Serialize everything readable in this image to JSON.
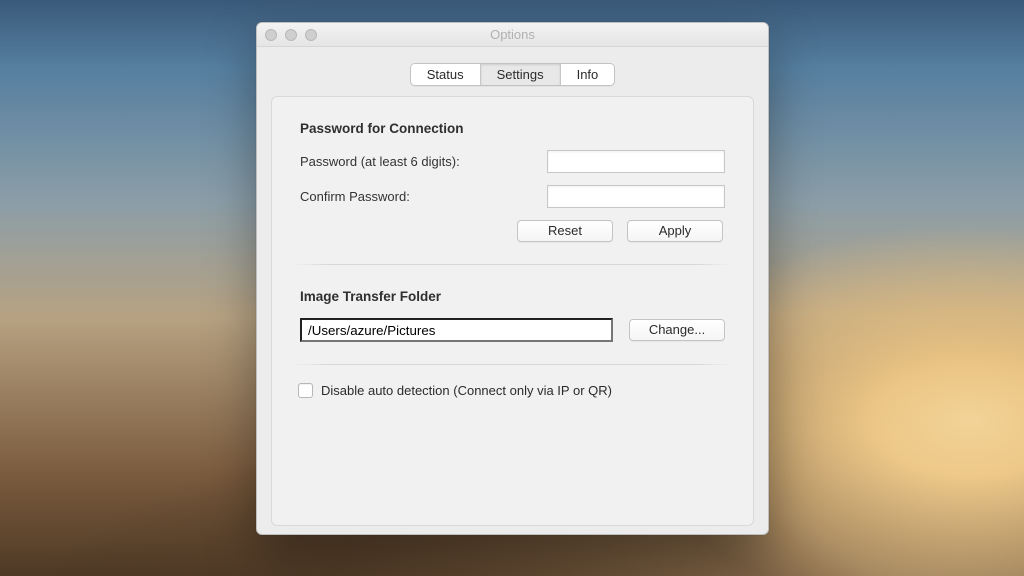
{
  "window": {
    "title": "Options"
  },
  "tabs": {
    "status": "Status",
    "settings": "Settings",
    "info": "Info",
    "active": "Settings"
  },
  "password_section": {
    "title": "Password for Connection",
    "password_label": "Password (at least 6 digits):",
    "password_value": "",
    "confirm_label": "Confirm Password:",
    "confirm_value": "",
    "reset_label": "Reset",
    "apply_label": "Apply"
  },
  "folder_section": {
    "title": "Image Transfer Folder",
    "path_value": "/Users/azure/Pictures",
    "change_label": "Change..."
  },
  "auto_detect": {
    "checked": false,
    "label": "Disable auto detection (Connect only via IP or QR)"
  }
}
